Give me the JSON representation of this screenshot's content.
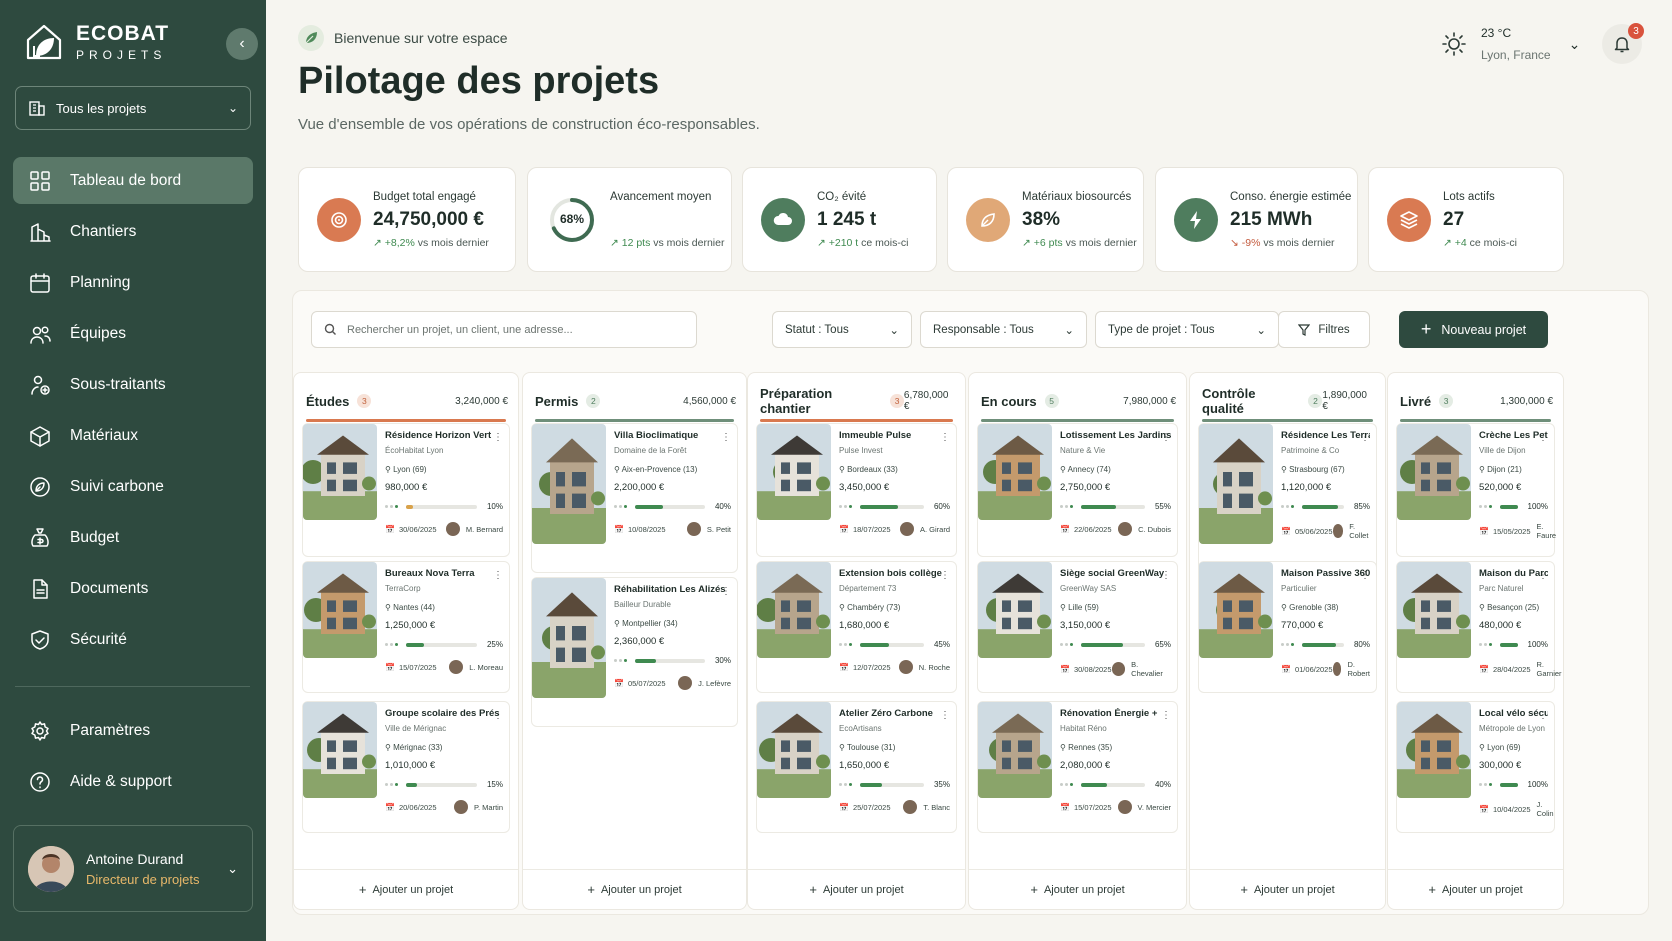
{
  "brand": {
    "name": "ECOBAT",
    "sub": "PROJETS"
  },
  "sidebar": {
    "project_select": "Tous les projets",
    "items": [
      {
        "label": "Tableau de bord",
        "icon": "grid-icon",
        "active": true
      },
      {
        "label": "Chantiers",
        "icon": "buildings-icon"
      },
      {
        "label": "Planning",
        "icon": "calendar-icon"
      },
      {
        "label": "Équipes",
        "icon": "team-icon"
      },
      {
        "label": "Sous-traitants",
        "icon": "subcontractor-icon"
      },
      {
        "label": "Matériaux",
        "icon": "box-icon"
      },
      {
        "label": "Suivi carbone",
        "icon": "leaf-circle-icon"
      },
      {
        "label": "Budget",
        "icon": "money-bag-icon"
      },
      {
        "label": "Documents",
        "icon": "document-icon"
      },
      {
        "label": "Sécurité",
        "icon": "shield-icon"
      }
    ],
    "bottom_items": [
      {
        "label": "Paramètres",
        "icon": "gear-icon"
      },
      {
        "label": "Aide & support",
        "icon": "help-icon"
      }
    ],
    "user": {
      "name": "Antoine Durand",
      "role": "Directeur de projets"
    }
  },
  "header": {
    "welcome": "Bienvenue sur votre espace",
    "title": "Pilotage des projets",
    "subtitle": "Vue d'ensemble de vos opérations de construction éco-responsables.",
    "weather": {
      "temp": "23 °C",
      "location": "Lyon, France"
    },
    "notifications": "3"
  },
  "kpis": [
    {
      "label": "Budget total engagé",
      "value": "24,750,000 €",
      "delta": "+8,2%",
      "delta_suffix": "vs mois dernier",
      "trend": "up",
      "color": "#d97a52",
      "icon": "target-icon"
    },
    {
      "label": "Avancement moyen",
      "value": "68%",
      "delta": "12 pts",
      "delta_suffix": "vs mois dernier",
      "trend": "up",
      "progress": 68,
      "icon": "progress-ring"
    },
    {
      "label": "CO₂ évité",
      "value": "1 245 t",
      "delta": "+210 t",
      "delta_suffix": "ce mois-ci",
      "trend": "up",
      "color": "#4f7d5e",
      "icon": "cloud-icon"
    },
    {
      "label": "Matériaux biosourcés",
      "value": "38%",
      "delta": "+6 pts",
      "delta_suffix": "vs mois dernier",
      "trend": "up",
      "color": "#e0a877",
      "icon": "leaf-icon"
    },
    {
      "label": "Conso. énergie estimée",
      "value": "215 MWh",
      "delta": "-9%",
      "delta_suffix": "vs mois dernier",
      "trend": "down",
      "color": "#4f7d5e",
      "icon": "bolt-icon"
    },
    {
      "label": "Lots actifs",
      "value": "27",
      "delta": "+4",
      "delta_suffix": "ce mois-ci",
      "trend": "up",
      "color": "#d97a52",
      "icon": "layers-icon"
    }
  ],
  "toolbar": {
    "search_placeholder": "Rechercher un projet, un client, une adresse...",
    "filters": [
      "Statut : Tous",
      "Responsable : Tous",
      "Type de projet : Tous"
    ],
    "filters_button": "Filtres",
    "new_button": "Nouveau projet"
  },
  "add_label": "Ajouter un projet",
  "columns": [
    {
      "title": "Études",
      "count": "3",
      "total": "3,240,000 €",
      "color": "#d9794f",
      "cards": [
        {
          "name": "Résidence Horizon Vert",
          "client": "ÉcoHabitat Lyon",
          "location": "Lyon (69)",
          "amount": "980,000 €",
          "progress": 10,
          "pct": "10%",
          "date": "30/06/2025",
          "owner": "M. Bernard",
          "barColor": "#d9a24a"
        },
        {
          "name": "Bureaux Nova Terra",
          "client": "TerraCorp",
          "location": "Nantes (44)",
          "amount": "1,250,000 €",
          "progress": 25,
          "pct": "25%",
          "date": "15/07/2025",
          "owner": "L. Moreau",
          "barColor": "#3f8a50"
        },
        {
          "name": "Groupe scolaire des Prés",
          "client": "Ville de Mérignac",
          "location": "Mérignac (33)",
          "amount": "1,010,000 €",
          "progress": 15,
          "pct": "15%",
          "date": "20/06/2025",
          "owner": "P. Martin",
          "barColor": "#3f8a50"
        }
      ]
    },
    {
      "title": "Permis",
      "count": "2",
      "total": "4,560,000 €",
      "color": "#6f8f7a",
      "cards": [
        {
          "name": "Villa Bioclimatique",
          "client": "Domaine de la Forêt",
          "location": "Aix-en-Provence (13)",
          "amount": "2,200,000 €",
          "progress": 40,
          "pct": "40%",
          "date": "10/08/2025",
          "owner": "S. Petit",
          "barColor": "#3f8a50"
        },
        {
          "name": "Réhabilitation Les Alizés",
          "client": "Bailleur Durable",
          "location": "Montpellier (34)",
          "amount": "2,360,000 €",
          "progress": 30,
          "pct": "30%",
          "date": "05/07/2025",
          "owner": "J. Lefèvre",
          "barColor": "#3f8a50"
        }
      ]
    },
    {
      "title": "Préparation chantier",
      "count": "3",
      "total": "6,780,000 €",
      "color": "#d9794f",
      "cards": [
        {
          "name": "Immeuble Pulse",
          "client": "Pulse Invest",
          "location": "Bordeaux (33)",
          "amount": "3,450,000 €",
          "progress": 60,
          "pct": "60%",
          "date": "18/07/2025",
          "owner": "A. Girard",
          "barColor": "#3f8a50"
        },
        {
          "name": "Extension bois collège",
          "client": "Département 73",
          "location": "Chambéry (73)",
          "amount": "1,680,000 €",
          "progress": 45,
          "pct": "45%",
          "date": "12/07/2025",
          "owner": "N. Roche",
          "barColor": "#3f8a50"
        },
        {
          "name": "Atelier Zéro Carbone",
          "client": "EcoArtisans",
          "location": "Toulouse (31)",
          "amount": "1,650,000 €",
          "progress": 35,
          "pct": "35%",
          "date": "25/07/2025",
          "owner": "T. Blanc",
          "barColor": "#3f8a50"
        }
      ]
    },
    {
      "title": "En cours",
      "count": "5",
      "total": "7,980,000 €",
      "color": "#6f8f7a",
      "cards": [
        {
          "name": "Lotissement Les Jardins",
          "client": "Nature & Vie",
          "location": "Annecy (74)",
          "amount": "2,750,000 €",
          "progress": 55,
          "pct": "55%",
          "date": "22/06/2025",
          "owner": "C. Dubois",
          "barColor": "#3f8a50"
        },
        {
          "name": "Siège social GreenWay",
          "client": "GreenWay SAS",
          "location": "Lille (59)",
          "amount": "3,150,000 €",
          "progress": 65,
          "pct": "65%",
          "date": "30/08/2025",
          "owner": "B. Chevalier",
          "barColor": "#3f8a50"
        },
        {
          "name": "Rénovation Énergie +",
          "client": "Habitat Réno",
          "location": "Rennes (35)",
          "amount": "2,080,000 €",
          "progress": 40,
          "pct": "40%",
          "date": "15/07/2025",
          "owner": "V. Mercier",
          "barColor": "#3f8a50"
        }
      ]
    },
    {
      "title": "Contrôle qualité",
      "count": "2",
      "total": "1,890,000 €",
      "color": "#6f8f7a",
      "cards": [
        {
          "name": "Résidence Les Terrasses",
          "client": "Patrimoine & Co",
          "location": "Strasbourg (67)",
          "amount": "1,120,000 €",
          "progress": 85,
          "pct": "85%",
          "date": "05/06/2025",
          "owner": "F. Collet",
          "barColor": "#3f8a50"
        },
        {
          "name": "Maison Passive 360",
          "client": "Particulier",
          "location": "Grenoble (38)",
          "amount": "770,000 €",
          "progress": 80,
          "pct": "80%",
          "date": "01/06/2025",
          "owner": "D. Robert",
          "barColor": "#3f8a50"
        }
      ]
    },
    {
      "title": "Livré",
      "count": "3",
      "total": "1,300,000 €",
      "color": "#6f8f7a",
      "cards": [
        {
          "name": "Crèche Les Petits Pousses",
          "client": "Ville de Dijon",
          "location": "Dijon (21)",
          "amount": "520,000 €",
          "progress": 100,
          "pct": "100%",
          "date": "15/05/2025",
          "owner": "E. Faure",
          "barColor": "#3f8a50"
        },
        {
          "name": "Maison du Parc",
          "client": "Parc Naturel",
          "location": "Besançon (25)",
          "amount": "480,000 €",
          "progress": 100,
          "pct": "100%",
          "date": "28/04/2025",
          "owner": "R. Garnier",
          "barColor": "#3f8a50"
        },
        {
          "name": "Local vélo sécurisé",
          "client": "Métropole de Lyon",
          "location": "Lyon (69)",
          "amount": "300,000 €",
          "progress": 100,
          "pct": "100%",
          "date": "10/04/2025",
          "owner": "J. Colin",
          "barColor": "#3f8a50"
        }
      ]
    }
  ]
}
